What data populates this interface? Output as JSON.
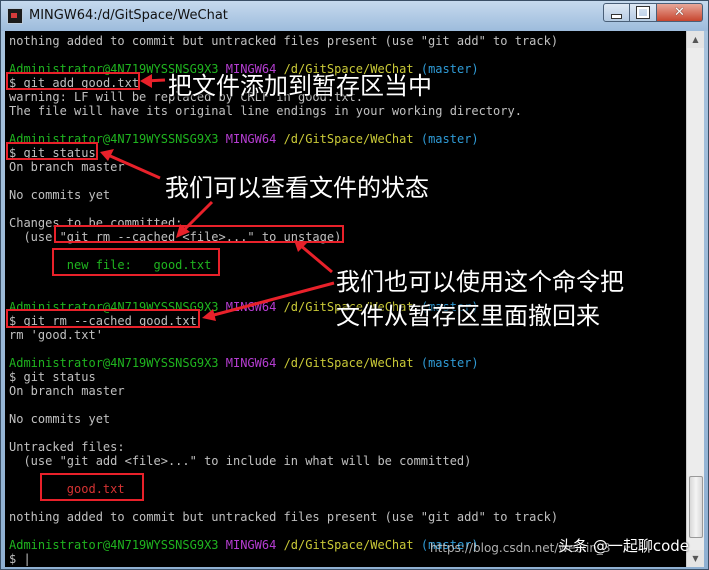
{
  "window": {
    "title": "MINGW64:/d/GitSpace/WeChat"
  },
  "prompt": {
    "user": "Administrator@4N719WYSSNSG9X3",
    "shell": "MINGW64",
    "path": "/d/GitSpace/WeChat",
    "branch": "(master)",
    "symbol": "$"
  },
  "terminal": {
    "l1": "nothing added to commit but untracked files present (use \"git add\" to track)",
    "cmd1": "git add good.txt",
    "l2": "warning: LF will be replaced by CRLF in good.txt.",
    "l3": "The file will have its original line endings in your working directory.",
    "cmd2": "git status",
    "l4": "On branch master",
    "l5": "No commits yet",
    "l6": "Changes to be committed:",
    "l7": "  (use \"git rm --cached <file>...\" to unstage)",
    "l8": "        new file:   good.txt",
    "cmd3": "git rm --cached good.txt",
    "l9": "rm 'good.txt'",
    "cmd4": "git status",
    "l10": "On branch master",
    "l11": "No commits yet",
    "l12": "Untracked files:",
    "l13": "  (use \"git add <file>...\" to include in what will be committed)",
    "l14": "        good.txt",
    "l15": "nothing added to commit but untracked files present (use \"git add\" to track)",
    "cursor": "|"
  },
  "annotations": {
    "a1": "把文件添加到暂存区当中",
    "a2": "我们可以查看文件的状态",
    "a3": "我们也可以使用这个命令把",
    "a4": "文件从暂存区里面撤回来"
  },
  "watermark": {
    "source": "头条 @一起聊code",
    "url": "https://blog.csdn.net/weixin_3"
  },
  "colors": {
    "user": "#1fb41f",
    "shell": "#b53dd1",
    "path": "#c9c937",
    "branch": "#2f9bd6",
    "annotation_red": "#e8212a"
  }
}
